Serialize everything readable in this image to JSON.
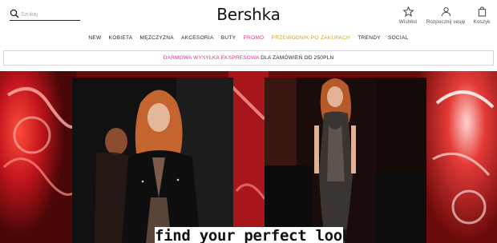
{
  "header": {
    "search_placeholder": "Szukaj",
    "logo": "Bershka",
    "wishlist_label": "Wishlist",
    "login_label": "Rozpocznij sesję",
    "cart_label": "Koszyk"
  },
  "nav": {
    "items": [
      "NEW",
      "KOBIETA",
      "MĘŻCZYZNA",
      "AKCESORIA",
      "BUTY",
      "PROMO",
      "PRZEWODNIK PO ZAKUPACH",
      "TRENDY",
      "SOCIAL"
    ]
  },
  "shipping": {
    "highlight": "DARMOWA WYSYŁKA EKSPRESOWA",
    "rest": "DLA ZAMÓWIEŃ OD 250PLN"
  },
  "hero": {
    "tagline": "find your perfect look"
  },
  "colors": {
    "promo": "#e0308a",
    "guide": "#c9a227",
    "hero_red": "#b3121b"
  },
  "icons": [
    "search-icon",
    "star-icon",
    "user-icon",
    "bag-icon"
  ]
}
